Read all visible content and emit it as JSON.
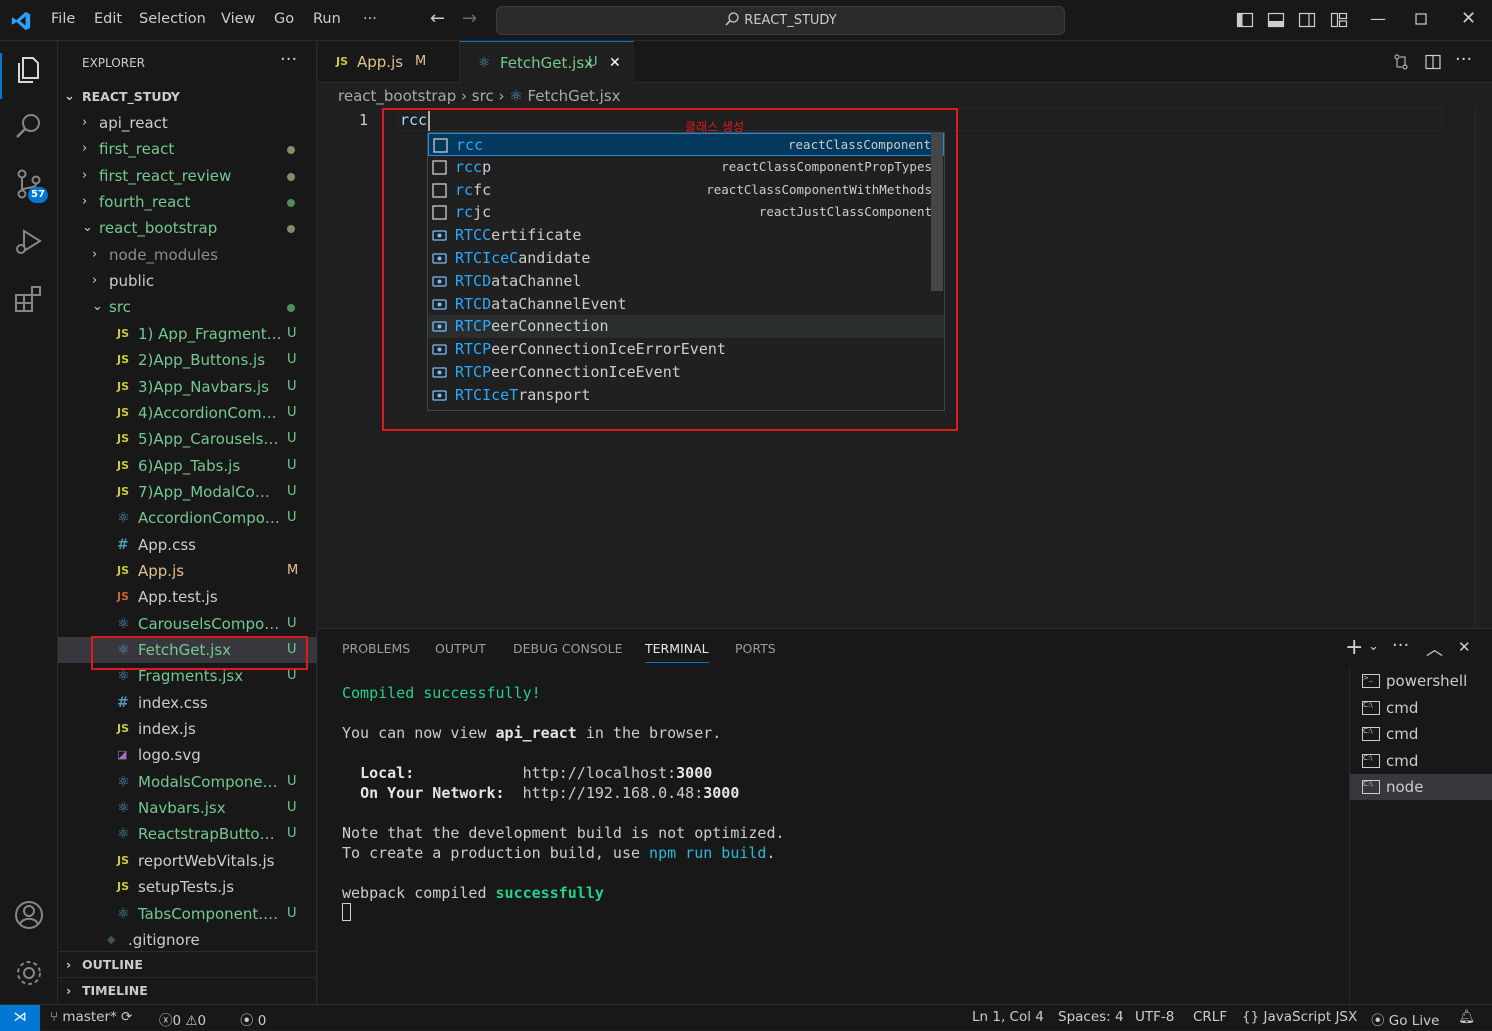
{
  "titlebar": {
    "menus": [
      "File",
      "Edit",
      "Selection",
      "View",
      "Go",
      "Run",
      "···"
    ],
    "search": "REACT_STUDY"
  },
  "activity": {
    "scm_badge": "57"
  },
  "explorer": {
    "title": "EXPLORER",
    "more": "···",
    "root": "REACT_STUDY",
    "items": [
      {
        "label": "api_react",
        "type": "folder",
        "depth": 0,
        "expanded": false,
        "color": "#cccccc",
        "status": ""
      },
      {
        "label": "first_react",
        "type": "folder",
        "depth": 0,
        "expanded": false,
        "color": "#73c991",
        "status": "dot",
        "dot": "#8a8a6a"
      },
      {
        "label": "first_react_review",
        "type": "folder",
        "depth": 0,
        "expanded": false,
        "color": "#73c991",
        "status": "dot",
        "dot": "#8a8a6a"
      },
      {
        "label": "fourth_react",
        "type": "folder",
        "depth": 0,
        "expanded": false,
        "color": "#73c991",
        "status": "dot",
        "dot": "#4e8e5e"
      },
      {
        "label": "react_bootstrap",
        "type": "folder",
        "depth": 0,
        "expanded": true,
        "color": "#73c991",
        "status": "dot",
        "dot": "#8a8a6a"
      },
      {
        "label": "node_modules",
        "type": "folder",
        "depth": 1,
        "expanded": false,
        "color": "#8c8c8c",
        "status": ""
      },
      {
        "label": "public",
        "type": "folder",
        "depth": 1,
        "expanded": false,
        "color": "#cccccc",
        "status": ""
      },
      {
        "label": "src",
        "type": "folder",
        "depth": 1,
        "expanded": true,
        "color": "#73c991",
        "status": "dot",
        "dot": "#4e8e5e"
      },
      {
        "label": "1) App_Fragments.js",
        "type": "js",
        "depth": 2,
        "color": "#73c991",
        "status": "U"
      },
      {
        "label": "2)App_Buttons.js",
        "type": "js",
        "depth": 2,
        "color": "#73c991",
        "status": "U"
      },
      {
        "label": "3)App_Navbars.js",
        "type": "js",
        "depth": 2,
        "color": "#73c991",
        "status": "U"
      },
      {
        "label": "4)AccordionCompone...",
        "type": "js",
        "depth": 2,
        "color": "#73c991",
        "status": "U"
      },
      {
        "label": "5)App_CarouselsCom...",
        "type": "js",
        "depth": 2,
        "color": "#73c991",
        "status": "U"
      },
      {
        "label": "6)App_Tabs.js",
        "type": "js",
        "depth": 2,
        "color": "#73c991",
        "status": "U"
      },
      {
        "label": "7)App_ModalCompon...",
        "type": "js",
        "depth": 2,
        "color": "#73c991",
        "status": "U"
      },
      {
        "label": "AccordionComponent...",
        "type": "jsx",
        "depth": 2,
        "color": "#73c991",
        "status": "U"
      },
      {
        "label": "App.css",
        "type": "css",
        "depth": 2,
        "color": "#cccccc",
        "status": ""
      },
      {
        "label": "App.js",
        "type": "js",
        "depth": 2,
        "color": "#e2c08d",
        "status": "M"
      },
      {
        "label": "App.test.js",
        "type": "jsred",
        "depth": 2,
        "color": "#cccccc",
        "status": ""
      },
      {
        "label": "CarouselsComponent...",
        "type": "jsx",
        "depth": 2,
        "color": "#73c991",
        "status": "U"
      },
      {
        "label": "FetchGet.jsx",
        "type": "jsx",
        "depth": 2,
        "color": "#73c991",
        "status": "U",
        "selected": true
      },
      {
        "label": "Fragments.jsx",
        "type": "jsx",
        "depth": 2,
        "color": "#73c991",
        "status": "U"
      },
      {
        "label": "index.css",
        "type": "css",
        "depth": 2,
        "color": "#cccccc",
        "status": ""
      },
      {
        "label": "index.js",
        "type": "js",
        "depth": 2,
        "color": "#cccccc",
        "status": ""
      },
      {
        "label": "logo.svg",
        "type": "svg",
        "depth": 2,
        "color": "#cccccc",
        "status": ""
      },
      {
        "label": "ModalsComponent.jsx",
        "type": "jsx",
        "depth": 2,
        "color": "#73c991",
        "status": "U"
      },
      {
        "label": "Navbars.jsx",
        "type": "jsx",
        "depth": 2,
        "color": "#73c991",
        "status": "U"
      },
      {
        "label": "ReactstrapButtons.jsx",
        "type": "jsx",
        "depth": 2,
        "color": "#73c991",
        "status": "U"
      },
      {
        "label": "reportWebVitals.js",
        "type": "js",
        "depth": 2,
        "color": "#cccccc",
        "status": ""
      },
      {
        "label": "setupTests.js",
        "type": "js",
        "depth": 2,
        "color": "#cccccc",
        "status": ""
      },
      {
        "label": "TabsComponent.jsx",
        "type": "jsx",
        "depth": 2,
        "color": "#73c991",
        "status": "U"
      },
      {
        "label": ".gitignore",
        "type": "git",
        "depth": 1,
        "color": "#cccccc",
        "status": ""
      }
    ],
    "outline": "OUTLINE",
    "timeline": "TIMELINE"
  },
  "tabs": [
    {
      "label": "App.js",
      "status": "M",
      "icon": "JS",
      "active": false
    },
    {
      "label": "FetchGet.jsx",
      "status": "U",
      "icon": "react",
      "active": true
    }
  ],
  "breadcrumb": {
    "a": "react_bootstrap",
    "b": "src",
    "c": "FetchGet.jsx"
  },
  "editor": {
    "line": "1",
    "code": "rcc"
  },
  "annotation": "클래스 생성",
  "suggest": [
    {
      "match": "rcc",
      "rest": "",
      "detail": "reactClassComponent",
      "kind": "snippet",
      "state": "selected"
    },
    {
      "match": "rcc",
      "rest": "p",
      "detail": "reactClassComponentPropTypes",
      "kind": "snippet"
    },
    {
      "match": "rc",
      "rest": "fc",
      "detail": "reactClassComponentWithMethods",
      "kind": "snippet"
    },
    {
      "match": "rc",
      "rest": "jc",
      "detail": "reactJustClassComponent",
      "kind": "snippet"
    },
    {
      "match": "RTCC",
      "rest": "ertificate",
      "detail": "",
      "kind": "variable"
    },
    {
      "match": "RTCIceC",
      "rest": "andidate",
      "detail": "",
      "kind": "variable"
    },
    {
      "match": "RTCD",
      "rest": "ataChannel",
      "detail": "",
      "kind": "variable"
    },
    {
      "match": "RTCD",
      "rest": "ataChannelEvent",
      "detail": "",
      "kind": "variable"
    },
    {
      "match": "RTCP",
      "rest": "eerConnection",
      "detail": "",
      "kind": "variable",
      "state": "hover"
    },
    {
      "match": "RTCP",
      "rest": "eerConnectionIceErrorEvent",
      "detail": "",
      "kind": "variable"
    },
    {
      "match": "RTCP",
      "rest": "eerConnectionIceEvent",
      "detail": "",
      "kind": "variable"
    },
    {
      "match": "RTCIceT",
      "rest": "ransport",
      "detail": "",
      "kind": "variable"
    }
  ],
  "panel": {
    "tabs": [
      "PROBLEMS",
      "OUTPUT",
      "DEBUG CONSOLE",
      "TERMINAL",
      "PORTS"
    ],
    "active_tab": "TERMINAL",
    "terminal": {
      "compiled": "Compiled successfully!",
      "view_pre": "You can now view ",
      "view_app": "api_react",
      "view_post": " in the browser.",
      "local_label": "Local:",
      "local_url": "http://localhost:",
      "port": "3000",
      "network_label": "On Your Network:",
      "network_url": "http://192.168.0.48:",
      "note1": "Note that the development build is not optimized.",
      "note2_pre": "To create a production build, use ",
      "note2_cmd": "npm run build",
      "note2_post": ".",
      "webpack_pre": "webpack compiled ",
      "webpack_ok": "successfully"
    },
    "terminals": [
      "powershell",
      "cmd",
      "cmd",
      "cmd",
      "node"
    ]
  },
  "status": {
    "branch": "master*",
    "errors": "0",
    "warnings": "0",
    "ports": "0",
    "position": "Ln 1, Col 4",
    "spaces": "Spaces: 4",
    "encoding": "UTF-8",
    "eol": "CRLF",
    "language": "JavaScript JSX",
    "golive": "Go Live"
  }
}
